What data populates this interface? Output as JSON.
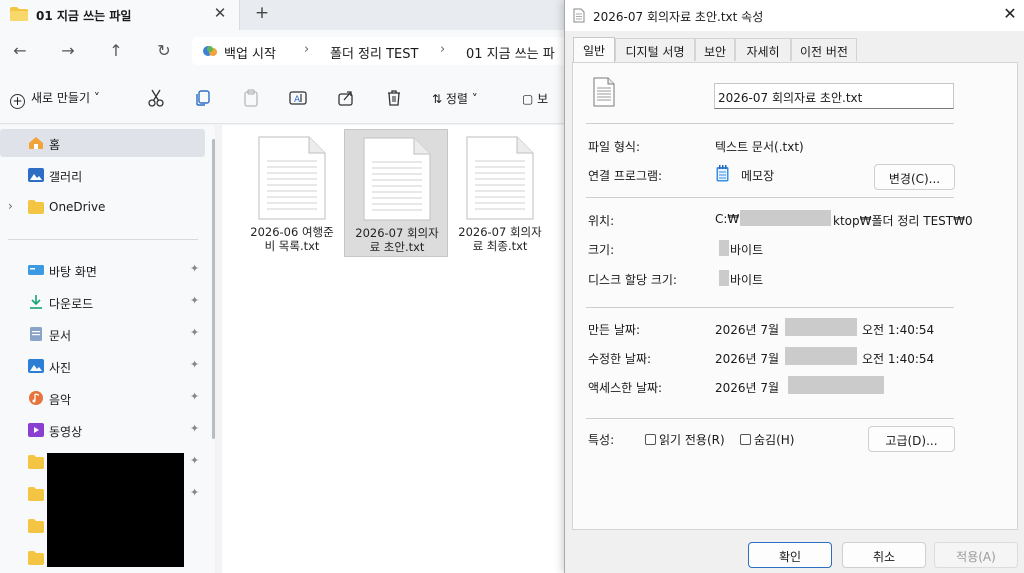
{
  "explorer": {
    "tab_title": "01 지금 쓰는 파일",
    "tab_close": "✕",
    "tab_new": "+",
    "nav": {
      "back": "←",
      "forward": "→",
      "up": "↑",
      "refresh": "↻"
    },
    "breadcrumb": [
      "백업 시작",
      "폴더 정리 TEST",
      "01 지금 쓰는 파"
    ],
    "breadcrumb_sep": "›",
    "commands": {
      "new": "새로 만들기",
      "new_chevron": "˅",
      "sort": "정렬",
      "sort_chevron": "˅",
      "view": "보"
    },
    "sidebar": {
      "items": [
        {
          "label": "홈",
          "icon": "home-icon"
        },
        {
          "label": "갤러리",
          "icon": "gallery-icon"
        },
        {
          "label": "OneDrive",
          "icon": "folder-icon"
        },
        {
          "label": "바탕 화면",
          "icon": "desktop-icon"
        },
        {
          "label": "다운로드",
          "icon": "download-icon"
        },
        {
          "label": "문서",
          "icon": "document-icon"
        },
        {
          "label": "사진",
          "icon": "pictures-icon"
        },
        {
          "label": "음악",
          "icon": "music-icon"
        },
        {
          "label": "동영상",
          "icon": "videos-icon"
        }
      ],
      "expand": "›",
      "pin": "📌"
    },
    "files": [
      {
        "name": "2026-06 여행준비 목록.txt",
        "line1": "2026-06 여행준",
        "line2": "비 목록.txt"
      },
      {
        "name": "2026-07 회의자료 초안.txt",
        "line1": "2026-07 회의자",
        "line2": "료 초안.txt"
      },
      {
        "name": "2026-07 회의자료 최종.txt",
        "line1": "2026-07 회의자",
        "line2": "료 최종.txt"
      }
    ]
  },
  "dialog": {
    "title": "2026-07 회의자료 초안.txt 속성",
    "close": "✕",
    "tabs": [
      "일반",
      "디지털 서명",
      "보안",
      "자세히",
      "이전 버전"
    ],
    "filename": "2026-07 회의자료 초안.txt",
    "file_type_label": "파일 형식:",
    "file_type": "텍스트 문서(.txt)",
    "opens_with_label": "연결 프로그램:",
    "opens_with": "메모장",
    "change_button": "변경(C)...",
    "location_label": "위치:",
    "location_start": "C:₩",
    "location_end": "ktop₩폴더 정리 TEST₩0",
    "size_label": "크기:",
    "size_unit": "바이트",
    "size_on_disk_label": "디스크 할당 크기:",
    "size_on_disk_unit": "바이트",
    "created_label": "만든 날짜:",
    "created_prefix": "2026년 7월",
    "created_time": "오전 1:40:54",
    "modified_label": "수정한 날짜:",
    "modified_prefix": "2026년 7월",
    "modified_time": "오전 1:40:54",
    "accessed_label": "액세스한 날짜:",
    "accessed_prefix": "2026년 7월",
    "attributes_label": "특성:",
    "readonly": "읽기 전용(R)",
    "hidden": "숨김(H)",
    "advanced_button": "고급(D)...",
    "ok": "확인",
    "cancel": "취소",
    "apply": "적용(A)"
  },
  "colors": {
    "accent": "#2d6ec4",
    "folder": "#f4c542",
    "selection": "#dcdcdc"
  }
}
